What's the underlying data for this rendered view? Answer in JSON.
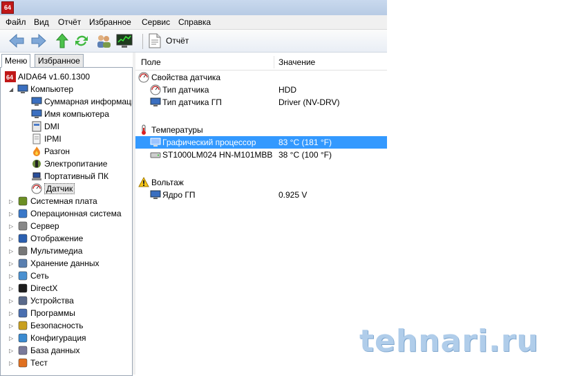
{
  "window": {
    "icon_text": "64"
  },
  "menu": [
    "Файл",
    "Вид",
    "Отчёт",
    "Избранное",
    "Сервис",
    "Справка"
  ],
  "toolbar": {
    "buttons": [
      "back-arrow-icon",
      "forward-arrow-icon",
      "up-arrow-icon",
      "refresh-icon",
      "users-icon",
      "monitor-chart-icon"
    ],
    "report_label": "Отчёт"
  },
  "tabs": {
    "menu": "Меню",
    "favorites": "Избранное"
  },
  "tree": {
    "root": "AIDA64 v1.60.1300",
    "computer": "Компьютер",
    "computer_children": [
      "Суммарная информация",
      "Имя компьютера",
      "DMI",
      "IPMI",
      "Разгон",
      "Электропитание",
      "Портативный ПК",
      "Датчик"
    ],
    "selected": "Датчик",
    "categories": [
      "Системная плата",
      "Операционная система",
      "Сервер",
      "Отображение",
      "Мультимедиа",
      "Хранение данных",
      "Сеть",
      "DirectX",
      "Устройства",
      "Программы",
      "Безопасность",
      "Конфигурация",
      "База данных",
      "Тест"
    ]
  },
  "list": {
    "headers": {
      "field": "Поле",
      "value": "Значение"
    },
    "groups": [
      {
        "title": "Свойства датчика",
        "icon": "gauge-icon",
        "rows": [
          {
            "field": "Тип датчика",
            "value": "HDD",
            "icon": "gauge-icon"
          },
          {
            "field": "Тип датчика ГП",
            "value": "Driver  (NV-DRV)",
            "icon": "monitor-icon"
          }
        ]
      },
      {
        "title": "Температуры",
        "icon": "thermometer-icon",
        "rows": [
          {
            "field": "Графический процессор",
            "value": "83 °C  (181 °F)",
            "icon": "monitor-icon",
            "selected": true
          },
          {
            "field": "ST1000LM024 HN-M101MBB",
            "value": "38 °C  (100 °F)",
            "icon": "hdd-icon"
          }
        ]
      },
      {
        "title": "Вольтаж",
        "icon": "warning-icon",
        "rows": [
          {
            "field": "Ядро ГП",
            "value": "0.925 V",
            "icon": "monitor-icon"
          }
        ]
      }
    ]
  },
  "watermark": "tehnari.ru"
}
